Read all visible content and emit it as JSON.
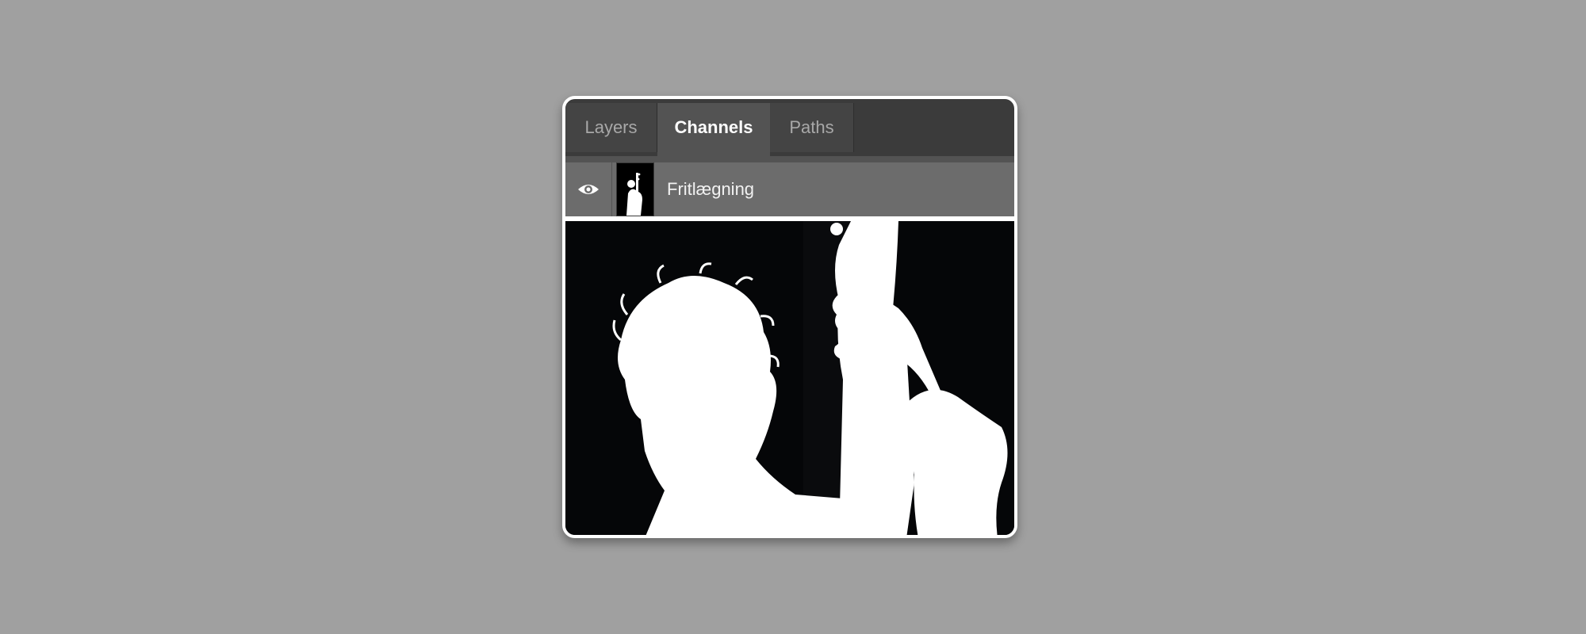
{
  "tabs": [
    {
      "label": "Layers",
      "active": false
    },
    {
      "label": "Channels",
      "active": true
    },
    {
      "label": "Paths",
      "active": false
    }
  ],
  "channel": {
    "name": "Fritlægning",
    "visibility_icon": "eye-icon",
    "visible": true
  },
  "colors": {
    "background": "#a0a0a0",
    "tabbar": "#3b3b3b",
    "active_tab": "#535353",
    "channel_row": "#6c6c6c",
    "mask_black": "#050608",
    "mask_white": "#ffffff"
  }
}
